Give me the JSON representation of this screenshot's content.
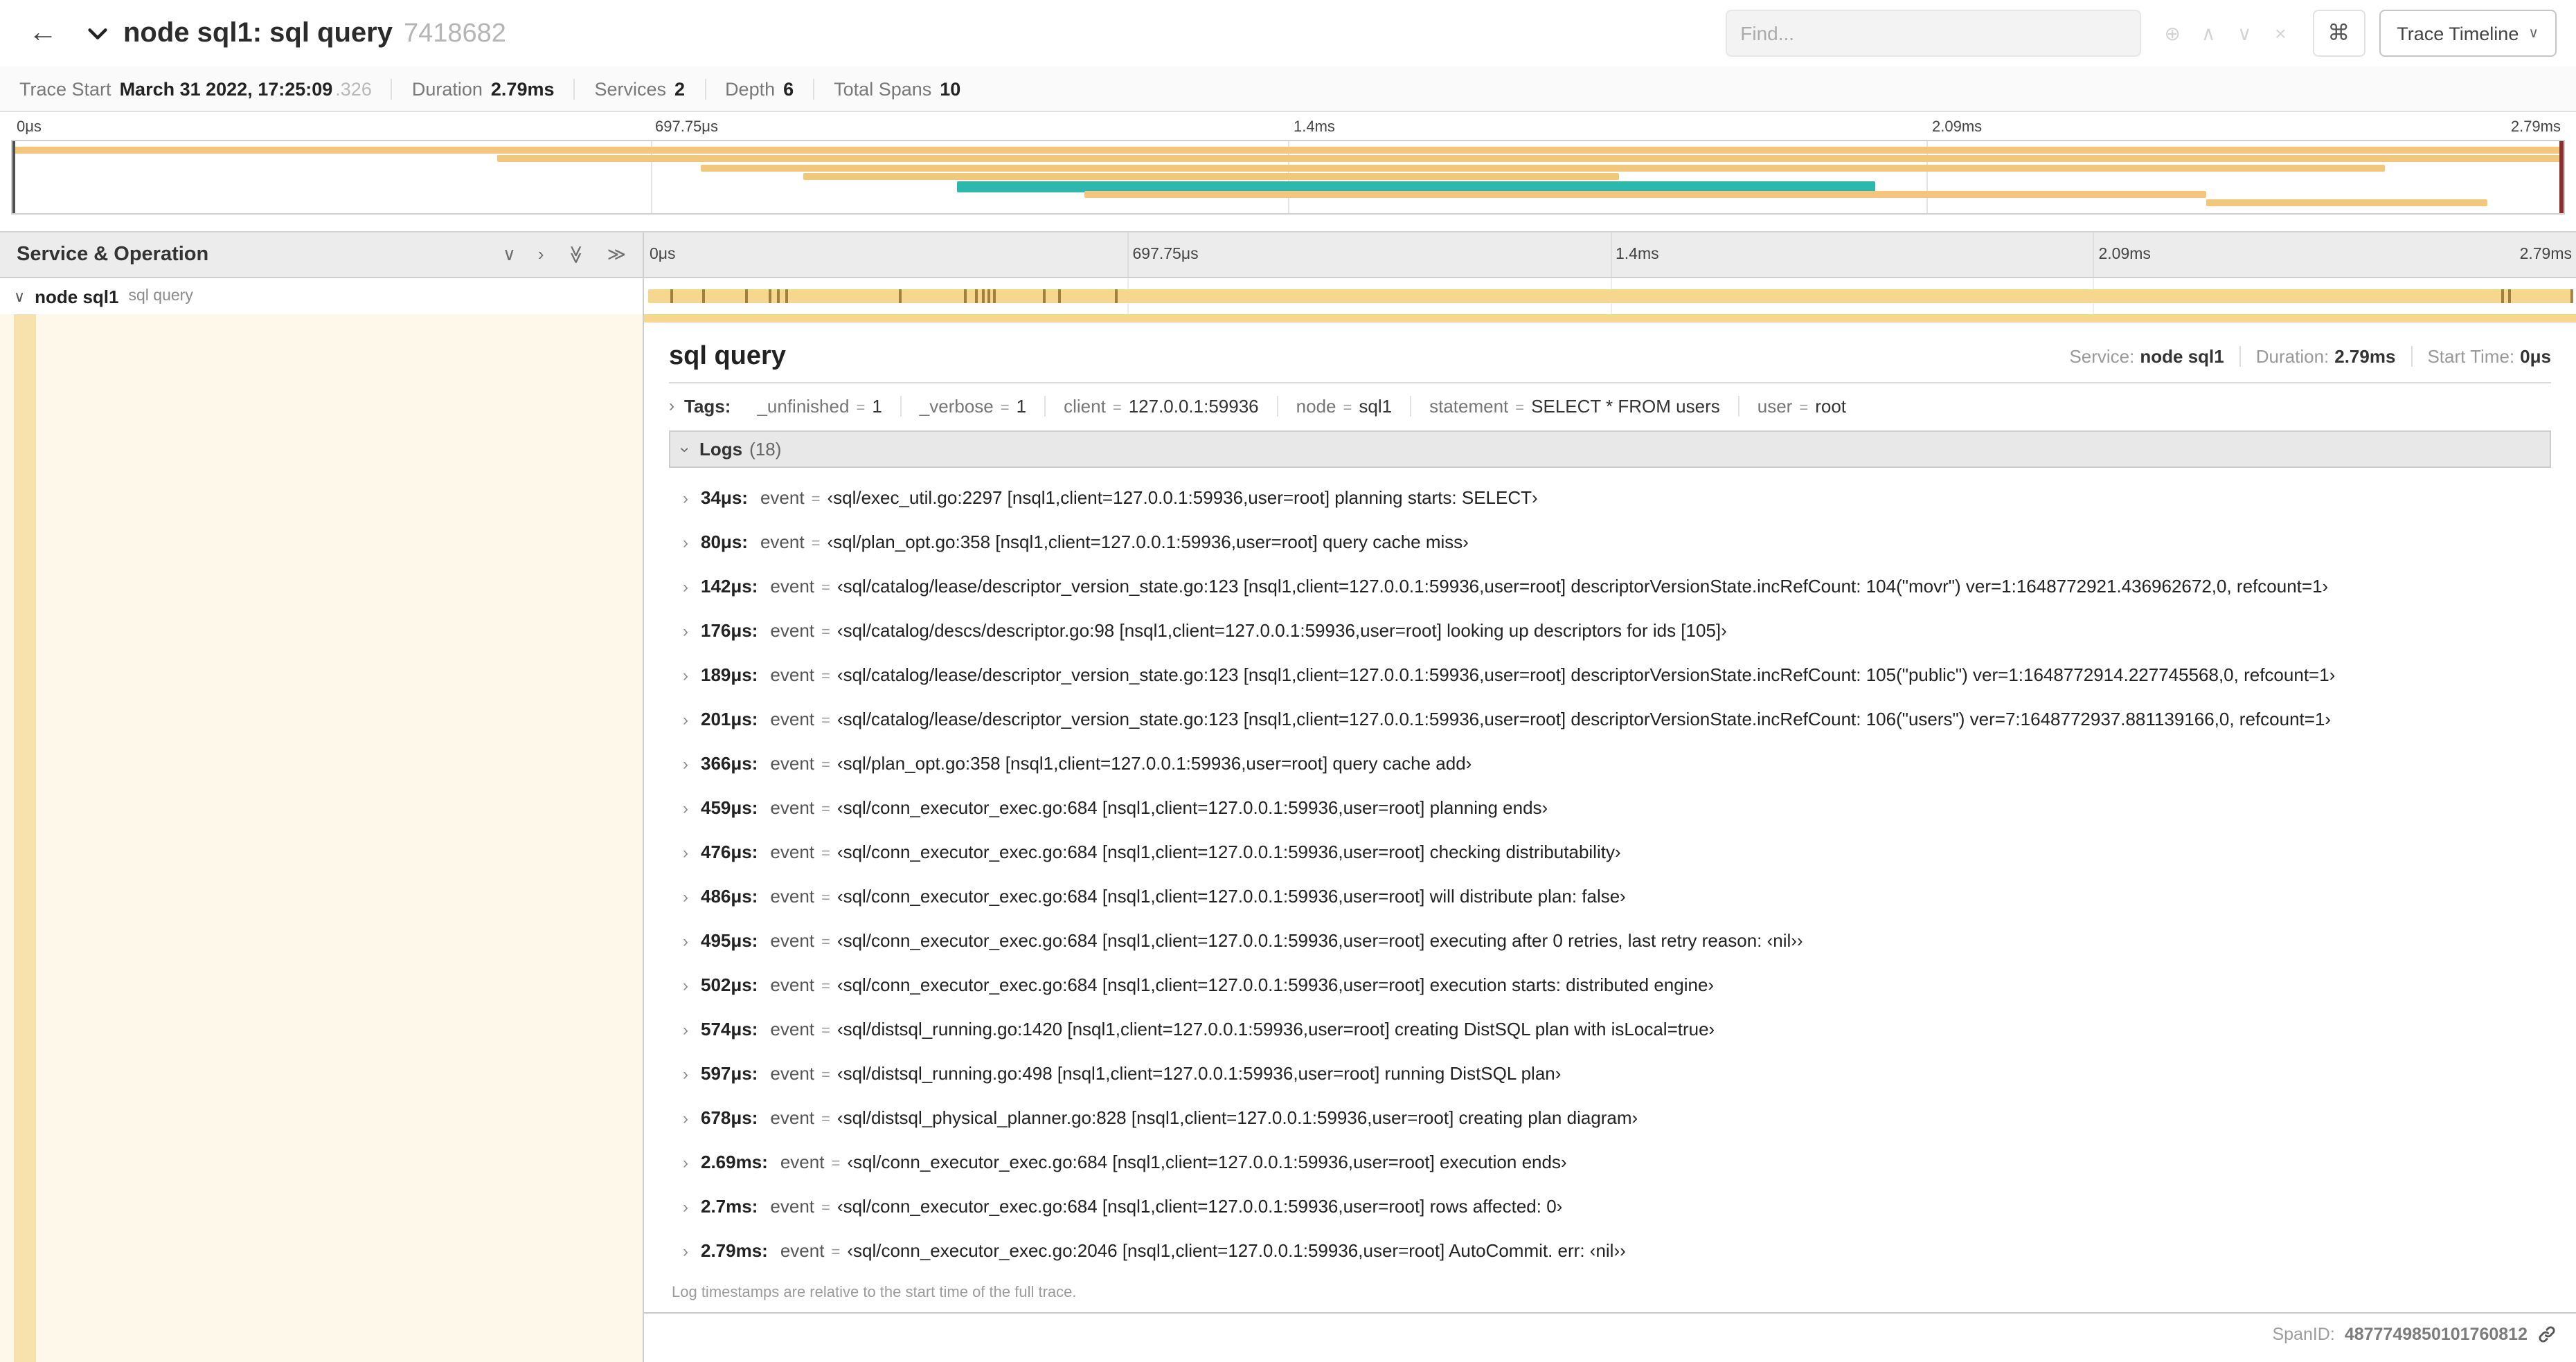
{
  "colors": {
    "span_tan": "#F6D78F",
    "minimap_tan": "#F1C87B",
    "teal": "#2CB8AC",
    "tick_brown": "#8C6A2B",
    "left_panel_cream": "#FDF8EA",
    "left_strip_tan": "#F7E2AE"
  },
  "header": {
    "title": "node sql1: sql query",
    "trace_id": "7418682",
    "find_placeholder": "Find...",
    "shortcut_key": "⌘",
    "view_dropdown": "Trace Timeline"
  },
  "summary": {
    "items": [
      {
        "label": "Trace Start",
        "value": "March 31 2022, 17:25:09",
        "suffix": ".326"
      },
      {
        "label": "Duration",
        "value": "2.79ms"
      },
      {
        "label": "Services",
        "value": "2"
      },
      {
        "label": "Depth",
        "value": "6"
      },
      {
        "label": "Total Spans",
        "value": "10"
      }
    ]
  },
  "minimap": {
    "ticks": [
      "0μs",
      "697.75μs",
      "1.4ms",
      "2.09ms",
      "2.79ms"
    ],
    "spans": [
      {
        "row": 0,
        "start": 0,
        "end": 100,
        "color": "tan"
      },
      {
        "row": 1,
        "start": 19,
        "end": 100,
        "color": "tan"
      },
      {
        "row": 2,
        "start": 27,
        "end": 93,
        "color": "tan"
      },
      {
        "row": 3,
        "start": 31,
        "end": 63,
        "color": "tan"
      },
      {
        "row": 4,
        "start": 37,
        "end": 73,
        "color": "teal"
      },
      {
        "row": 5,
        "start": 42,
        "end": 86,
        "color": "tan"
      },
      {
        "row": 6,
        "start": 86,
        "end": 97,
        "color": "tan"
      }
    ]
  },
  "timeline": {
    "left_header": "Service & Operation",
    "ruler_ticks": [
      "0μs",
      "697.75μs",
      "1.4ms",
      "2.09ms",
      "2.79ms"
    ],
    "row": {
      "service": "node sql1",
      "operation": "sql query"
    },
    "span_bar": {
      "duration_us": 2790,
      "log_times_us": [
        34,
        80,
        142,
        176,
        189,
        201,
        366,
        459,
        476,
        486,
        495,
        502,
        574,
        597,
        678,
        2690,
        2700,
        2790
      ]
    }
  },
  "detail": {
    "title": "sql query",
    "meta": [
      {
        "label": "Service:",
        "value": "node sql1"
      },
      {
        "label": "Duration:",
        "value": "2.79ms"
      },
      {
        "label": "Start Time:",
        "value": "0μs"
      }
    ],
    "tags_label": "Tags:",
    "tags": [
      {
        "key": "_unfinished",
        "value": "1"
      },
      {
        "key": "_verbose",
        "value": "1"
      },
      {
        "key": "client",
        "value": "127.0.0.1:59936"
      },
      {
        "key": "node",
        "value": "sql1"
      },
      {
        "key": "statement",
        "value": "SELECT * FROM users"
      },
      {
        "key": "user",
        "value": "root"
      }
    ],
    "logs_label": "Logs",
    "logs_count": "(18)",
    "logs": [
      {
        "time": "34μs:",
        "key": "event",
        "value": "‹sql/exec_util.go:2297 [nsql1,client=127.0.0.1:59936,user=root] planning starts: SELECT›"
      },
      {
        "time": "80μs:",
        "key": "event",
        "value": "‹sql/plan_opt.go:358 [nsql1,client=127.0.0.1:59936,user=root] query cache miss›"
      },
      {
        "time": "142μs:",
        "key": "event",
        "value": "‹sql/catalog/lease/descriptor_version_state.go:123 [nsql1,client=127.0.0.1:59936,user=root] descriptorVersionState.incRefCount: 104(\"movr\") ver=1:1648772921.436962672,0, refcount=1›"
      },
      {
        "time": "176μs:",
        "key": "event",
        "value": "‹sql/catalog/descs/descriptor.go:98 [nsql1,client=127.0.0.1:59936,user=root] looking up descriptors for ids [105]›"
      },
      {
        "time": "189μs:",
        "key": "event",
        "value": "‹sql/catalog/lease/descriptor_version_state.go:123 [nsql1,client=127.0.0.1:59936,user=root] descriptorVersionState.incRefCount: 105(\"public\") ver=1:1648772914.227745568,0, refcount=1›"
      },
      {
        "time": "201μs:",
        "key": "event",
        "value": "‹sql/catalog/lease/descriptor_version_state.go:123 [nsql1,client=127.0.0.1:59936,user=root] descriptorVersionState.incRefCount: 106(\"users\") ver=7:1648772937.881139166,0, refcount=1›"
      },
      {
        "time": "366μs:",
        "key": "event",
        "value": "‹sql/plan_opt.go:358 [nsql1,client=127.0.0.1:59936,user=root] query cache add›"
      },
      {
        "time": "459μs:",
        "key": "event",
        "value": "‹sql/conn_executor_exec.go:684 [nsql1,client=127.0.0.1:59936,user=root] planning ends›"
      },
      {
        "time": "476μs:",
        "key": "event",
        "value": "‹sql/conn_executor_exec.go:684 [nsql1,client=127.0.0.1:59936,user=root] checking distributability›"
      },
      {
        "time": "486μs:",
        "key": "event",
        "value": "‹sql/conn_executor_exec.go:684 [nsql1,client=127.0.0.1:59936,user=root] will distribute plan: false›"
      },
      {
        "time": "495μs:",
        "key": "event",
        "value": "‹sql/conn_executor_exec.go:684 [nsql1,client=127.0.0.1:59936,user=root] executing after 0 retries, last retry reason: ‹nil››"
      },
      {
        "time": "502μs:",
        "key": "event",
        "value": "‹sql/conn_executor_exec.go:684 [nsql1,client=127.0.0.1:59936,user=root] execution starts: distributed engine›"
      },
      {
        "time": "574μs:",
        "key": "event",
        "value": "‹sql/distsql_running.go:1420 [nsql1,client=127.0.0.1:59936,user=root] creating DistSQL plan with isLocal=true›"
      },
      {
        "time": "597μs:",
        "key": "event",
        "value": "‹sql/distsql_running.go:498 [nsql1,client=127.0.0.1:59936,user=root] running DistSQL plan›"
      },
      {
        "time": "678μs:",
        "key": "event",
        "value": "‹sql/distsql_physical_planner.go:828 [nsql1,client=127.0.0.1:59936,user=root] creating plan diagram›"
      },
      {
        "time": "2.69ms:",
        "key": "event",
        "value": "‹sql/conn_executor_exec.go:684 [nsql1,client=127.0.0.1:59936,user=root] execution ends›"
      },
      {
        "time": "2.7ms:",
        "key": "event",
        "value": "‹sql/conn_executor_exec.go:684 [nsql1,client=127.0.0.1:59936,user=root] rows affected: 0›"
      },
      {
        "time": "2.79ms:",
        "key": "event",
        "value": "‹sql/conn_executor_exec.go:2046 [nsql1,client=127.0.0.1:59936,user=root] AutoCommit. err: ‹nil››"
      }
    ],
    "footnote": "Log timestamps are relative to the start time of the full trace.",
    "span_id_label": "SpanID:",
    "span_id": "4877749850101760812"
  }
}
